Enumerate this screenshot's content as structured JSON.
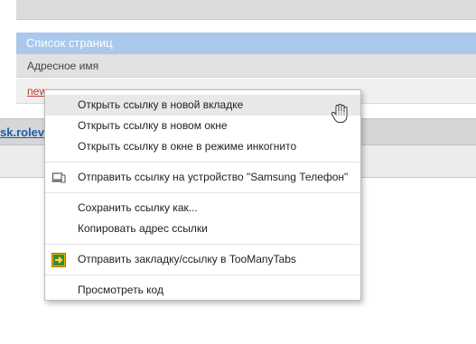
{
  "page": {
    "panel_title": "Список страниц",
    "column_header": "Адресное имя",
    "row_link": "new",
    "band_link": "sk.rolev"
  },
  "context_menu": {
    "items": [
      {
        "label": "Открыть ссылку в новой вкладке",
        "highlighted": true
      },
      {
        "label": "Открыть ссылку в новом окне"
      },
      {
        "label": "Открыть ссылку в окне в режиме инкогнито"
      },
      {
        "label": "Отправить ссылку на устройство \"Samsung Телефон\"",
        "icon": "send-to-device-icon"
      },
      {
        "label": "Сохранить ссылку как..."
      },
      {
        "label": "Копировать адрес ссылки"
      },
      {
        "label": "Отправить закладку/ссылку в TooManyTabs",
        "icon": "toomanytabs-extension-icon"
      },
      {
        "label": "Просмотреть код"
      }
    ]
  },
  "colors": {
    "panel_header_bg": "#a9c8ec",
    "row_link": "#c0392b",
    "band_link": "#1a5fa8",
    "menu_highlight": "#e8e8e8"
  }
}
